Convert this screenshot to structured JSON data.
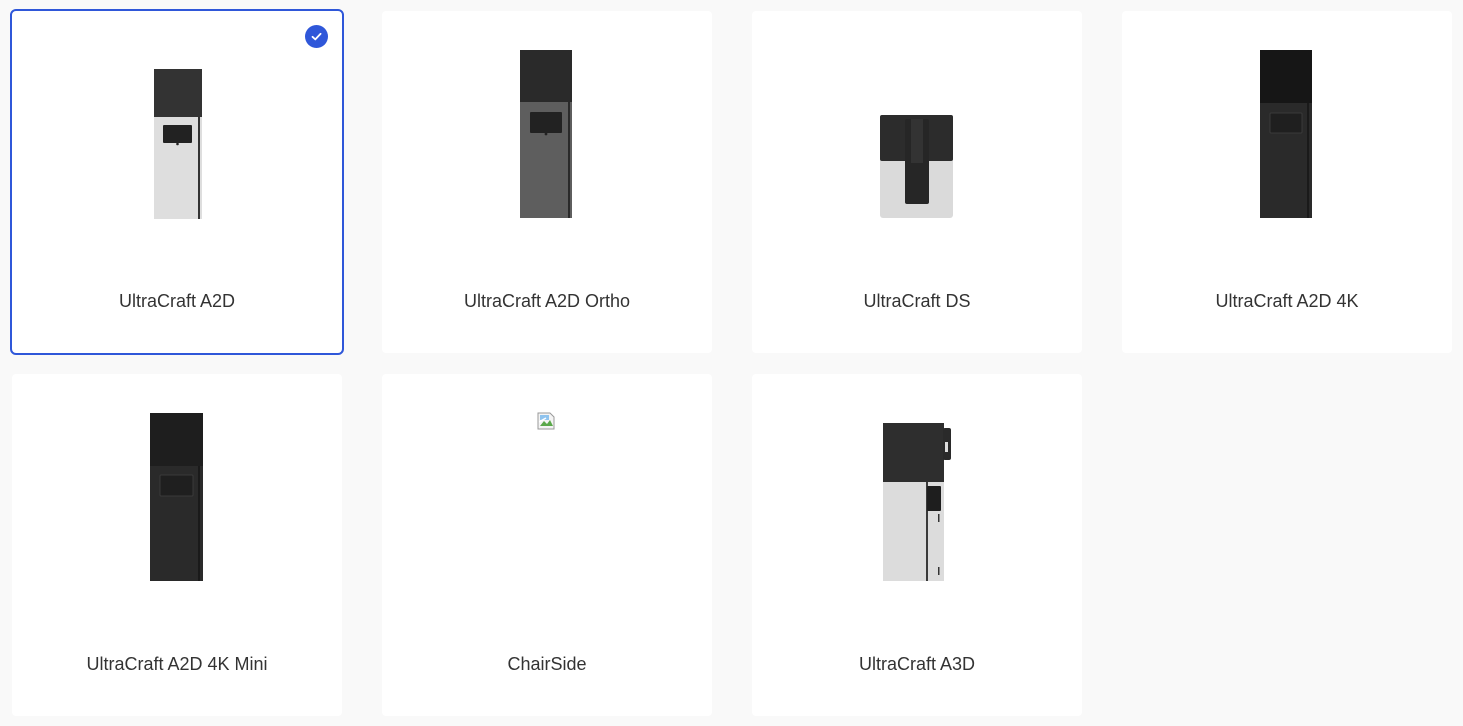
{
  "printers": [
    {
      "name": "UltraCraft A2D",
      "selected": true
    },
    {
      "name": "UltraCraft A2D Ortho",
      "selected": false
    },
    {
      "name": "UltraCraft DS",
      "selected": false
    },
    {
      "name": "UltraCraft A2D 4K",
      "selected": false
    },
    {
      "name": "UltraCraft A2D 4K Mini",
      "selected": false
    },
    {
      "name": "ChairSide",
      "selected": false
    },
    {
      "name": "UltraCraft A3D",
      "selected": false
    }
  ],
  "colors": {
    "accent": "#2f57d9",
    "background": "#f9f9f9",
    "card": "#ffffff"
  },
  "icons": {
    "selected": "checkmark-icon",
    "missing_image": "broken-image-icon"
  }
}
